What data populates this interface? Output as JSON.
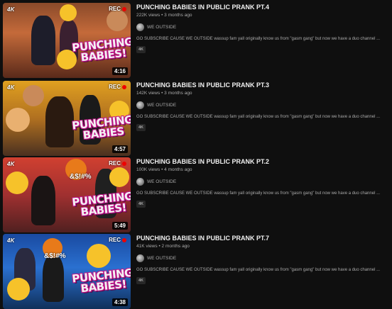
{
  "videos": [
    {
      "title": "PUNCHING BABIES IN PUBLIC PRANK PT.4",
      "views": "222K views",
      "age": "3 months ago",
      "channel": "WE OUTSIDE",
      "description": "GO SUBSCRIBE CAUSE WE OUTSIDE wassup fam yall originally know us from \"gasm gang\" but now we have a duo channel ...",
      "tag": "4K",
      "duration": "4:16",
      "thumb_text": "PUNCHING BABIES!",
      "badge_4k": "4K",
      "badge_rec": "REC"
    },
    {
      "title": "PUNCHING BABIES IN PUBLIC PRANK PT.3",
      "views": "142K views",
      "age": "3 months ago",
      "channel": "WE OUTSIDE",
      "description": "GO SUBSCRIBE CAUSE WE OUTSIDE wassup fam yall originally know us from \"gasm gang\" but now we have a duo channel ...",
      "tag": "4K",
      "duration": "4:57",
      "thumb_text": "PUNCHING BABIES",
      "badge_4k": "4K",
      "badge_rec": "REC"
    },
    {
      "title": "PUNCHING BABIES IN PUBLIC PRANK PT.2",
      "views": "100K views",
      "age": "4 months ago",
      "channel": "WE OUTSIDE",
      "description": "GO SUBSCRIBE CAUSE WE OUTSIDE wassup fam yall originally know us from \"gasm gang\" but now we have a duo channel ...",
      "tag": "4K",
      "duration": "5:49",
      "thumb_text": "PUNCHING BABIES!",
      "badge_4k": "4K",
      "badge_rec": "REC",
      "thumb_symbols": "&$!#%"
    },
    {
      "title": "PUNCHING BABIES IN PUBLIC PRANK PT.7",
      "views": "41K views",
      "age": "2 months ago",
      "channel": "WE OUTSIDE",
      "description": "GO SUBSCRIBE CAUSE WE OUTSIDE wassup fam yall originally know us from \"gasm gang\" but now we have a duo channel ...",
      "tag": "4K",
      "duration": "4:38",
      "thumb_text": "PUNCHING BABIES!",
      "badge_4k": "4K",
      "badge_rec": "REC",
      "thumb_symbols": "&$!#%"
    }
  ],
  "stats_separator": "•",
  "colors": {
    "background": "#0f0f0f",
    "title": "#f1f1f1",
    "secondary": "#aaaaaa",
    "tag_bg": "#272727",
    "thumb_text_outline": "#c0178a"
  }
}
